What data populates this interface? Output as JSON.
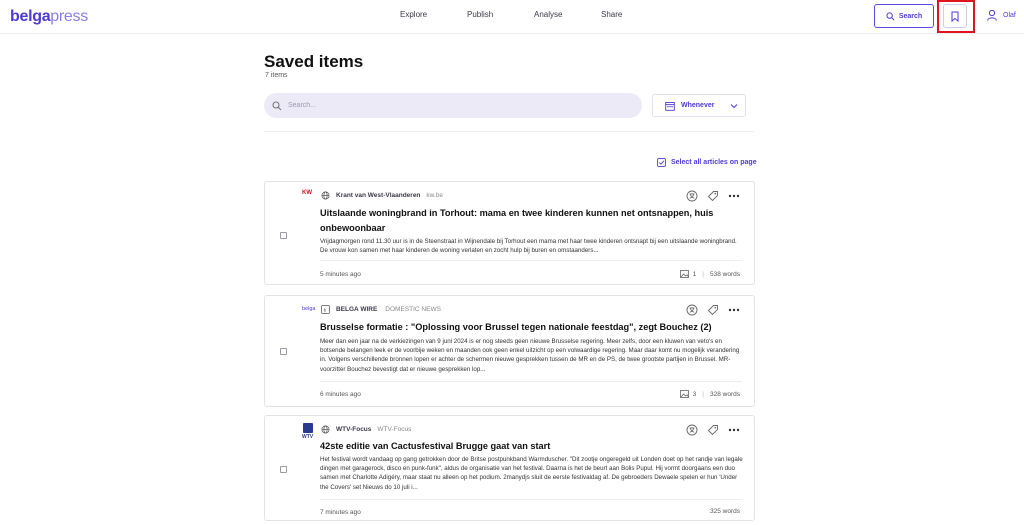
{
  "app": {
    "logo_bold": "belga",
    "logo_light": "press"
  },
  "nav": [
    "Explore",
    "Publish",
    "Analyse",
    "Share"
  ],
  "header": {
    "search_label": "Search",
    "user_name": "Olaf"
  },
  "page": {
    "title": "Saved items",
    "count": "7 items"
  },
  "search": {
    "placeholder": "Search..."
  },
  "date_filter": {
    "label": "Whenever"
  },
  "select_all": {
    "label": "Select all articles on page"
  },
  "articles": [
    {
      "source_logo": "KW",
      "source": "Krant van West-Vlaanderen",
      "sub": "kw.be",
      "title": "Uitslaande woningbrand in Torhout: mama en twee kinderen kunnen net ontsnappen, huis onbewoonbaar",
      "snippet": "Vrijdagmorgen rond 11.30 uur is in de Steenstraat in Wijnendale bij Torhout een mama met haar twee kinderen ontsnapt bij een uitslaande woningbrand. De vrouw kon samen met haar kinderen de woning verlaten en zocht hulp bij buren en omstaanders...",
      "time": "5 minutes ago",
      "images": "1",
      "words": "538 words"
    },
    {
      "source_logo": "belga",
      "source": "BELGA WIRE",
      "sub": "DOMESTIC NEWS",
      "title": "Brusselse formatie : \"Oplossing voor Brussel tegen nationale feestdag\", zegt Bouchez (2)",
      "snippet": "Meer dan een jaar na de verkiezingen van 9 juni 2024 is er nog steeds geen nieuwe Brusselse regering. Meer zelfs, door een kluwen van veto's en botsende belangen leek er de voorbije weken en maanden ook geen enkel uitzicht op een volwaardige regering. Maar daar komt nu mogelijk verandering in.  Volgens verschillende bronnen lopen er achter de schermen nieuwe gesprekken tussen de MR en de PS, de twee grootste partijen in Brussel. MR-voorzitter Bouchez bevestigt dat er nieuwe gesprekken lop...",
      "time": "6 minutes ago",
      "images": "3",
      "words": "328 words"
    },
    {
      "source_logo": "WTV",
      "source": "WTV-Focus",
      "sub": "WTV-Focus",
      "title": "42ste editie van Cactusfestival Brugge gaat van start",
      "snippet": "Het festival wordt vandaag op gang getrokken door de Britse postpunkband Warmduscher. \"Dit zootje ongeregeld uit Londen doet op het randje van legale dingen met garagerock, disco en punk-funk\", aldus de organisatie van het festival. Daarna is het de beurt aan Bolis Pupul. Hij vormt doorgaans een duo samen met Charlotte Adigéry, maar staat nu alleen op het podium. 2manydjs sluit de eerste festivaldag af. De gebroeders Dewaele spelen er hun 'Under the Covers' set Nieuws do 10 juli i...",
      "time": "7 minutes ago",
      "words": "325 words"
    }
  ],
  "colors": {
    "accent": "#4c3bd6",
    "highlight": "#e0141e"
  }
}
